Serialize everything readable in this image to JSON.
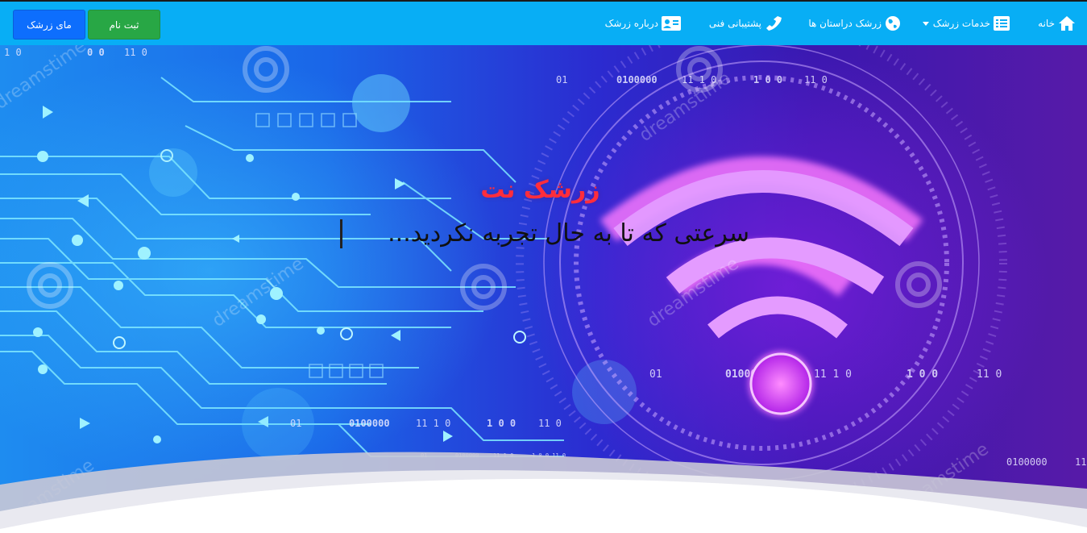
{
  "navbar": {
    "items": [
      {
        "label": "خانه",
        "icon": "home-icon"
      },
      {
        "label": "خدمات زرشک",
        "icon": "list-icon"
      },
      {
        "label": "زرشک دراستان ها",
        "icon": "globe-icon"
      },
      {
        "label": "پشتیبانی فنی",
        "icon": "phone-icon"
      },
      {
        "label": "درباره زرشک",
        "icon": "id-card-icon"
      }
    ],
    "register_label": "ثبت نام",
    "login_label": "مای زرشک"
  },
  "hero": {
    "title": "زرشک نت",
    "subtitle": "سرعتی که تا به حال تجربه نکردید..."
  },
  "colors": {
    "navbar_bg": "#08aef5",
    "register_bg": "#28a745",
    "login_bg": "#0d6efd",
    "title_color": "#ff2d3c"
  }
}
